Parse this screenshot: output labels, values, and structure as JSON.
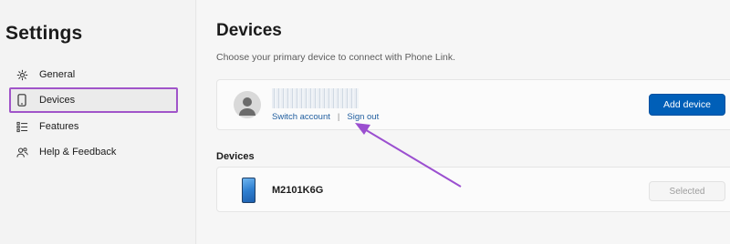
{
  "sidebar": {
    "title": "Settings",
    "items": [
      {
        "label": "General",
        "icon": "gear-icon"
      },
      {
        "label": "Devices",
        "icon": "phone-icon",
        "active": true
      },
      {
        "label": "Features",
        "icon": "list-icon"
      },
      {
        "label": "Help & Feedback",
        "icon": "people-icon"
      }
    ]
  },
  "main": {
    "title": "Devices",
    "subtitle": "Choose your primary device to connect with Phone Link.",
    "account": {
      "switch_label": "Switch account",
      "separator": "|",
      "signout_label": "Sign out",
      "add_button_label": "Add device"
    },
    "devices_section_label": "Devices",
    "devices": [
      {
        "name": "M2101K6G",
        "status": "Selected"
      }
    ]
  },
  "colors": {
    "accent": "#005fb8",
    "highlight_box": "#a054c9",
    "annotation_arrow": "#9b4fd0"
  }
}
